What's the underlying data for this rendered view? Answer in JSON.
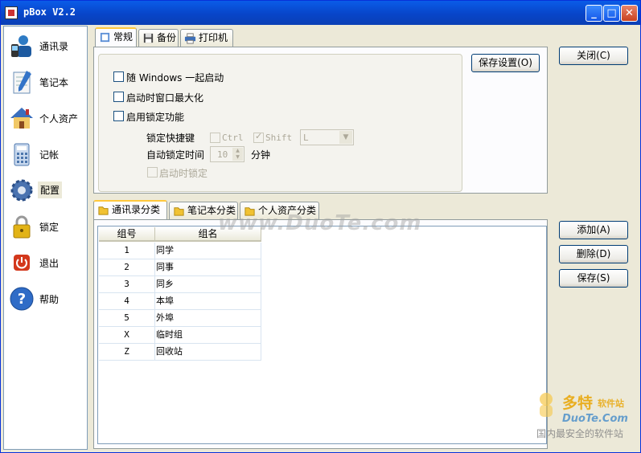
{
  "window": {
    "title": "pBox  V2.2"
  },
  "sidebar": {
    "items": [
      {
        "label": "通讯录",
        "icon": "address-book-icon"
      },
      {
        "label": "笔记本",
        "icon": "notebook-icon"
      },
      {
        "label": "个人资产",
        "icon": "house-icon"
      },
      {
        "label": "记帐",
        "icon": "calculator-icon"
      },
      {
        "label": "配置",
        "icon": "gear-icon"
      },
      {
        "label": "锁定",
        "icon": "lock-icon"
      },
      {
        "label": "退出",
        "icon": "exit-icon"
      },
      {
        "label": "帮助",
        "icon": "help-icon"
      }
    ],
    "selected": "配置"
  },
  "top_tabs": [
    {
      "label": "常规"
    },
    {
      "label": "备份"
    },
    {
      "label": "打印机"
    }
  ],
  "general": {
    "startup_with_windows": "随 Windows 一起启动",
    "maximize_on_start": "启动时窗口最大化",
    "enable_lock": "启用锁定功能",
    "lock_hotkey_label": "锁定快捷键",
    "ctrl_label": "Ctrl",
    "shift_label": "Shift",
    "hotkey_value": "L",
    "auto_lock_label": "自动锁定时间",
    "auto_lock_value": "10",
    "auto_lock_unit": "分钟",
    "lock_on_start": "启动时锁定",
    "save_button": "保存设置(O)"
  },
  "close_button": "关闭(C)",
  "bottom_tabs": [
    {
      "label": "通讯录分类"
    },
    {
      "label": "笔记本分类"
    },
    {
      "label": "个人资产分类"
    }
  ],
  "table": {
    "columns": [
      "组号",
      "组名"
    ],
    "rows": [
      {
        "id": "1",
        "name": "同学"
      },
      {
        "id": "2",
        "name": "同事"
      },
      {
        "id": "3",
        "name": "同乡"
      },
      {
        "id": "4",
        "name": "本埠"
      },
      {
        "id": "5",
        "name": "外埠"
      },
      {
        "id": "X",
        "name": "临时组"
      },
      {
        "id": "Z",
        "name": "回收站"
      }
    ]
  },
  "actions": {
    "add": "添加(A)",
    "delete": "删除(D)",
    "save": "保存(S)"
  },
  "watermark": "www.DuoTe.com",
  "brand": {
    "name": "多特",
    "sub": "软件站",
    "url": "DuoTe.Com",
    "slogan": "国内最安全的软件站"
  },
  "colors": {
    "titlebar": "#0a4fd6",
    "accent_tab": "#ffc83c",
    "face": "#ece9d8"
  }
}
